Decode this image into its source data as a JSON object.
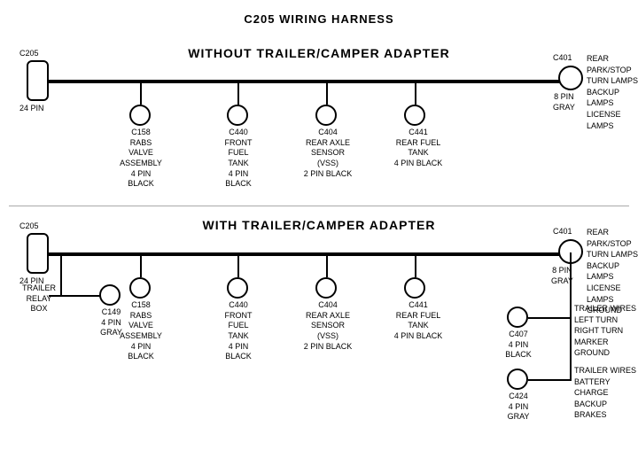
{
  "title": "C205 WIRING HARNESS",
  "sections": [
    {
      "id": "top",
      "label": "WITHOUT  TRAILER/CAMPER  ADAPTER",
      "connectors": [
        {
          "id": "C205_top",
          "type": "rect",
          "label": "C205",
          "subLabel": "24 PIN"
        },
        {
          "id": "C401_top",
          "type": "circle",
          "label": "C401",
          "subLabel": "8 PIN\nGRAY",
          "rightLabel": "REAR PARK/STOP\nTURN LAMPS\nBACKUP LAMPS\nLICENSE LAMPS"
        },
        {
          "id": "C158_top",
          "type": "circle",
          "label": "C158",
          "subLabel": "RABS VALVE\nASSEMBLY\n4 PIN BLACK"
        },
        {
          "id": "C440_top",
          "type": "circle",
          "label": "C440",
          "subLabel": "FRONT FUEL\nTANK\n4 PIN BLACK"
        },
        {
          "id": "C404_top",
          "type": "circle",
          "label": "C404",
          "subLabel": "REAR AXLE\nSENSOR\n(VSS)\n2 PIN BLACK"
        },
        {
          "id": "C441_top",
          "type": "circle",
          "label": "C441",
          "subLabel": "REAR FUEL\nTANK\n4 PIN BLACK"
        }
      ]
    },
    {
      "id": "bottom",
      "label": "WITH  TRAILER/CAMPER  ADAPTER",
      "connectors": [
        {
          "id": "C205_bot",
          "type": "rect",
          "label": "C205",
          "subLabel": "24 PIN"
        },
        {
          "id": "C401_bot",
          "type": "circle",
          "label": "C401",
          "subLabel": "8 PIN\nGRAY",
          "rightLabel": "REAR PARK/STOP\nTURN LAMPS\nBACKUP LAMPS\nLICENSE LAMPS\nGROUND"
        },
        {
          "id": "C158_bot",
          "type": "circle",
          "label": "C158",
          "subLabel": "RABS VALVE\nASSEMBLY\n4 PIN BLACK"
        },
        {
          "id": "C440_bot",
          "type": "circle",
          "label": "C440",
          "subLabel": "FRONT FUEL\nTANK\n4 PIN BLACK"
        },
        {
          "id": "C404_bot",
          "type": "circle",
          "label": "C404",
          "subLabel": "REAR AXLE\nSENSOR\n(VSS)\n2 PIN BLACK"
        },
        {
          "id": "C441_bot",
          "type": "circle",
          "label": "C441",
          "subLabel": "REAR FUEL\nTANK\n4 PIN BLACK"
        },
        {
          "id": "C149_bot",
          "type": "circle",
          "label": "C149",
          "subLabel": "4 PIN GRAY"
        },
        {
          "id": "C407_bot",
          "type": "circle",
          "label": "C407",
          "subLabel": "4 PIN\nBLACK",
          "rightLabel": "TRAILER WIRES\nLEFT TURN\nRIGHT TURN\nMARKER\nGROUND"
        },
        {
          "id": "C424_bot",
          "type": "circle",
          "label": "C424",
          "subLabel": "4 PIN\nGRAY",
          "rightLabel": "TRAILER WIRES\nBATTERY CHARGE\nBACKUP\nBRAKES"
        }
      ]
    }
  ]
}
